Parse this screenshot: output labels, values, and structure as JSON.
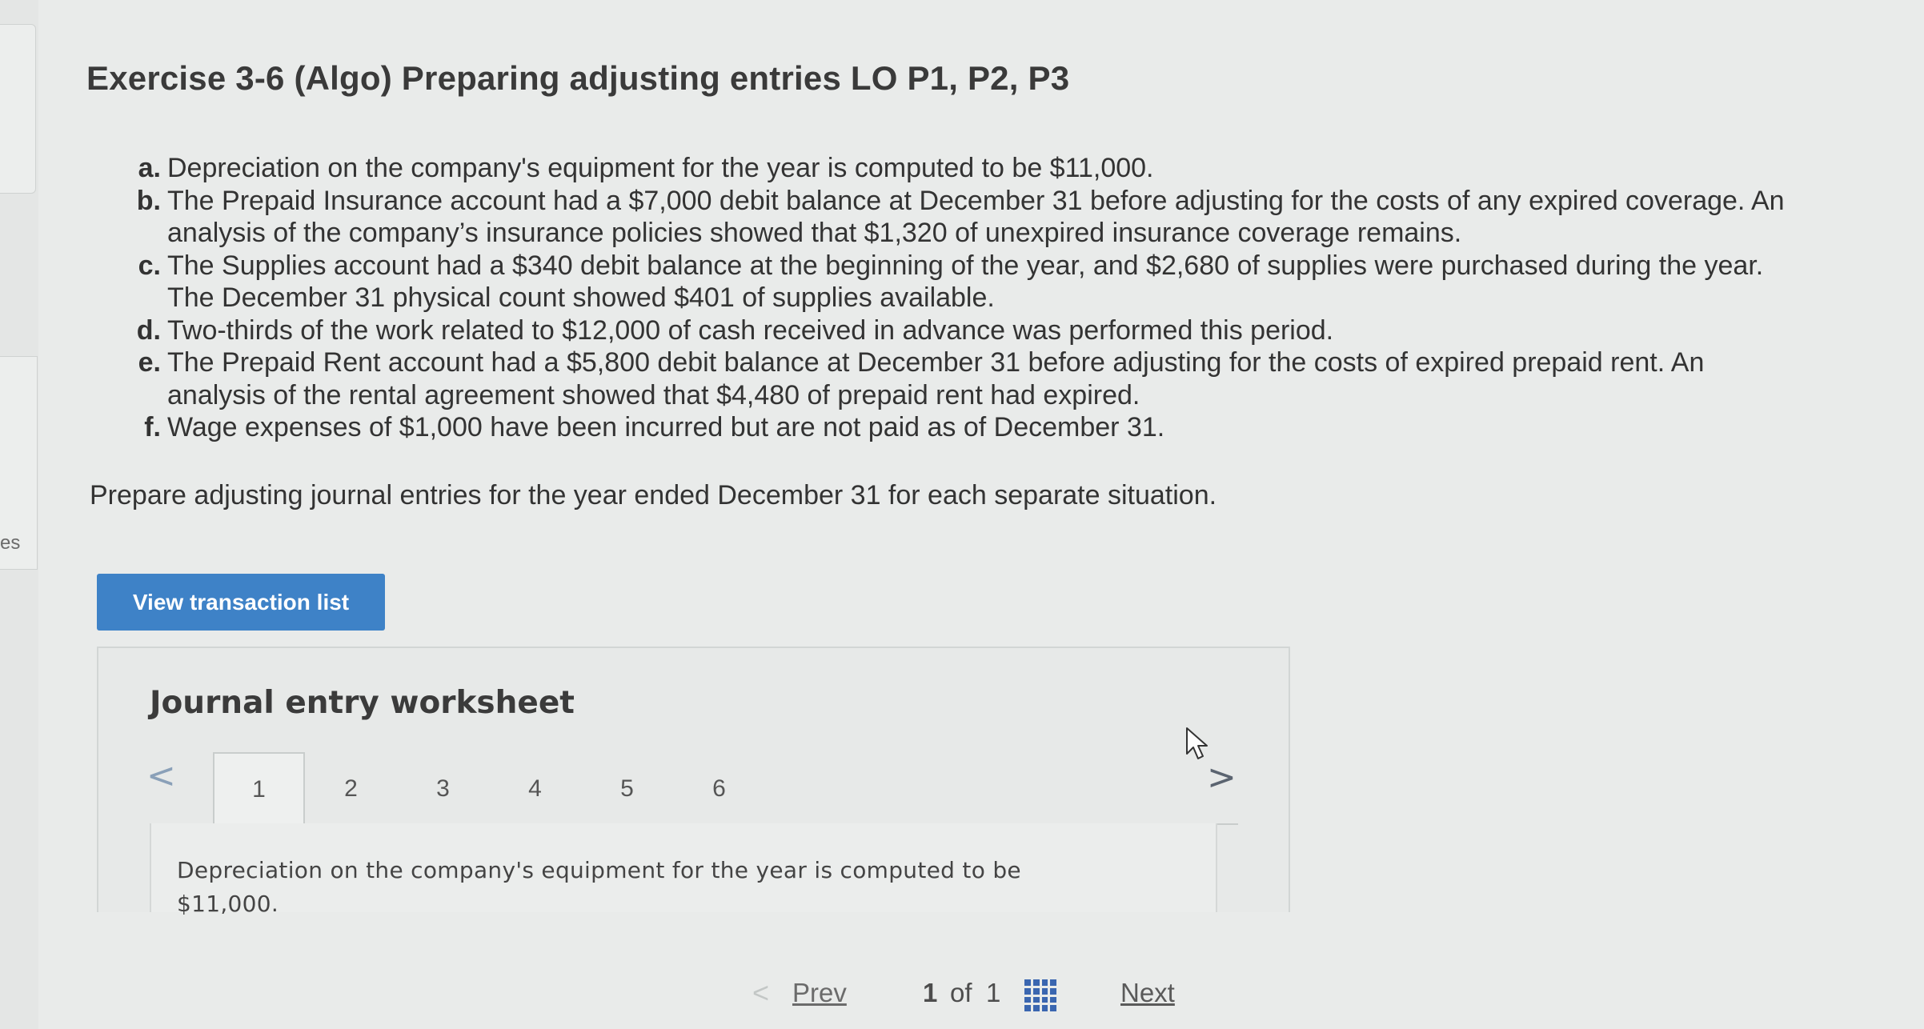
{
  "sidebar_fragment": "es",
  "exercise": {
    "title": "Exercise 3-6 (Algo) Preparing adjusting entries LO P1, P2, P3",
    "items": [
      {
        "letter": "a.",
        "text": "Depreciation on the company's equipment for the year is computed to be $11,000."
      },
      {
        "letter": "b.",
        "text": "The Prepaid Insurance account had a $7,000 debit balance at December 31 before adjusting for the costs of any expired coverage. An analysis of the company’s insurance policies showed that $1,320 of unexpired insurance coverage remains."
      },
      {
        "letter": "c.",
        "text": "The Supplies account had a $340 debit balance at the beginning of the year, and $2,680 of supplies were purchased during the year. The December 31 physical count showed $401 of supplies available."
      },
      {
        "letter": "d.",
        "text": "Two-thirds of the work related to $12,000 of cash received in advance was performed this period."
      },
      {
        "letter": "e.",
        "text": "The Prepaid Rent account had a $5,800 debit balance at December 31 before adjusting for the costs of expired prepaid rent. An analysis of the rental agreement showed that $4,480 of prepaid rent had expired."
      },
      {
        "letter": "f.",
        "text": "Wage expenses of $1,000 have been incurred but are not paid as of December 31."
      }
    ],
    "instruction": "Prepare adjusting journal entries for the year ended December 31 for each separate situation."
  },
  "view_transaction_label": "View transaction list",
  "worksheet": {
    "title": "Journal entry worksheet",
    "tabs": [
      "1",
      "2",
      "3",
      "4",
      "5",
      "6"
    ],
    "active_tab": "1",
    "description": "Depreciation on the company's equipment for the year is computed to be $11,000."
  },
  "pagination": {
    "prev": "Prev",
    "current": "1",
    "of": "of",
    "total": "1",
    "next": "Next"
  },
  "colors": {
    "accent_button": "#3e82c7",
    "grid_icon": "#3a66b0"
  },
  "icons": {
    "worksheet_prev": "chevron-left-icon",
    "worksheet_next": "chevron-right-icon",
    "pager_prev": "chevron-left-icon",
    "pager_grid": "grid-icon",
    "cursor": "mouse-pointer-icon"
  }
}
